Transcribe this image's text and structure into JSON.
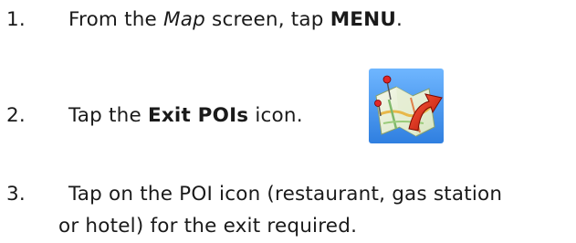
{
  "steps": [
    {
      "number": "1.",
      "parts": [
        "From the ",
        "Map",
        " screen, tap ",
        "MENU",
        "."
      ]
    },
    {
      "number": "2.",
      "parts": [
        "Tap the ",
        "Exit POIs",
        " icon."
      ],
      "icon": "exit-pois-map-icon"
    },
    {
      "number": "3.",
      "line1": "Tap on the POI icon (restaurant, gas station",
      "line2": "or hotel) for the exit required."
    }
  ]
}
